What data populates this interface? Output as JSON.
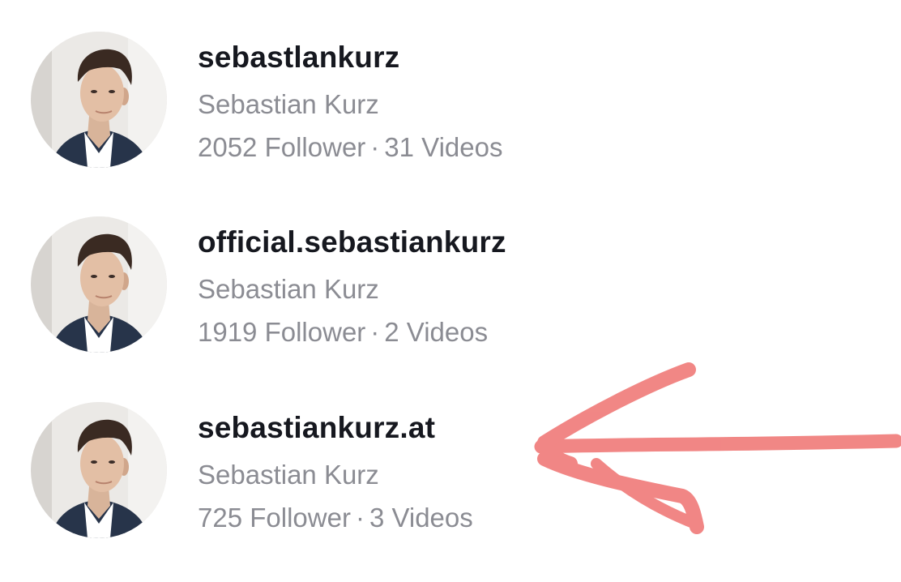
{
  "results": [
    {
      "handle": "sebastlankurz",
      "name": "Sebastian Kurz",
      "followers": "2052 Follower",
      "separator": "·",
      "videos": "31 Videos"
    },
    {
      "handle": "official.sebastiankurz",
      "name": "Sebastian Kurz",
      "followers": "1919 Follower",
      "separator": "·",
      "videos": "2 Videos"
    },
    {
      "handle": "sebastiankurz.at",
      "name": "Sebastian Kurz",
      "followers": "725 Follower",
      "separator": "·",
      "videos": "3 Videos"
    }
  ],
  "annotation": {
    "icon": "hand-drawn-arrow-icon",
    "color": "#f07a78"
  },
  "colors": {
    "handle": "#16181f",
    "secondary_text": "#8b8c93",
    "background": "#ffffff"
  }
}
